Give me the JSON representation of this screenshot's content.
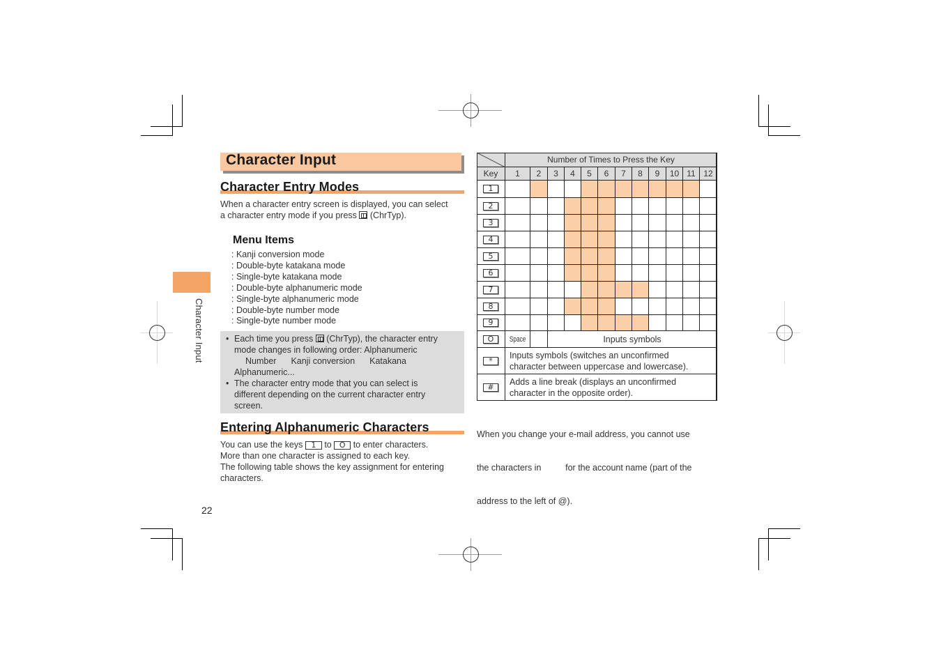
{
  "page": {
    "title": "Character Input",
    "page_number": "22",
    "side_tab_label": "Character Input",
    "accent_color": "#f5a468",
    "title_fill_color": "#fbc79f",
    "highlight_color": "#fbcfa8"
  },
  "section_entry_modes": {
    "heading": "Character Entry Modes",
    "intro_line1": "When a character entry screen is displayed, you can select",
    "intro_line2_before": "a character entry mode if you press ",
    "intro_line2_icon": "chrtyp-key-icon",
    "intro_line2_after": " (ChrTyp).",
    "menu_title": "Menu Items",
    "menu_items": [
      ": Kanji conversion mode",
      ": Double-byte katakana mode",
      ": Single-byte katakana mode",
      ": Double-byte alphanumeric mode",
      ": Single-byte alphanumeric mode",
      ": Double-byte number mode",
      ": Single-byte number mode"
    ],
    "notes": [
      {
        "bullet": "•",
        "line1_before": "Each time you press ",
        "line1_after": " (ChrTyp), the character entry",
        "line2": "mode changes in following order: Alphanumeric",
        "line3_items": [
          "Number",
          "Kanji conversion",
          "Katakana"
        ],
        "line4": "Alphanumeric..."
      },
      {
        "bullet": "•",
        "line1": "The character entry mode that you can select is",
        "line2": "different depending on the current character entry",
        "line3": "screen."
      }
    ]
  },
  "section_alphanumeric": {
    "heading": "Entering Alphanumeric Characters",
    "line1_before": "You can use the keys ",
    "key_from": "1",
    "line1_mid": " to ",
    "key_to": "O",
    "line1_after": " to enter characters.",
    "line2": "More than one character is assigned to each key.",
    "line3": "The following table shows the key assignment for entering",
    "line4": "characters."
  },
  "key_table": {
    "header_caption": "Number of Times to Press the Key",
    "key_column_label": "Key",
    "press_counts": [
      "1",
      "2",
      "3",
      "4",
      "5",
      "6",
      "7",
      "8",
      "9",
      "10",
      "11",
      "12"
    ],
    "rows": [
      {
        "key": "1",
        "highlighted": [
          2,
          5,
          6,
          7,
          8,
          9,
          10,
          11
        ]
      },
      {
        "key": "2",
        "highlighted": [
          4,
          5,
          6
        ]
      },
      {
        "key": "3",
        "highlighted": [
          4,
          5,
          6
        ]
      },
      {
        "key": "4",
        "highlighted": [
          4,
          5,
          6
        ]
      },
      {
        "key": "5",
        "highlighted": [
          4,
          5,
          6
        ]
      },
      {
        "key": "6",
        "highlighted": [
          4,
          5,
          6
        ]
      },
      {
        "key": "7",
        "highlighted": [
          5,
          6,
          7,
          8
        ]
      },
      {
        "key": "8",
        "highlighted": [
          4,
          5,
          6
        ]
      },
      {
        "key": "9",
        "highlighted": [
          5,
          6,
          7,
          8
        ]
      }
    ],
    "zero_row": {
      "key": "O",
      "press1": "Space",
      "rest": "Inputs symbols"
    },
    "star_row": {
      "key": "*",
      "line1": "Inputs symbols (switches an unconfirmed",
      "line2": "character between uppercase and lowercase)."
    },
    "hash_row": {
      "key": "#",
      "line1": "Adds a line break (displays an unconfirmed",
      "line2": "character in the opposite order)."
    }
  },
  "footnote": {
    "line1": "When you change your e-mail address, you cannot use",
    "line2": "the characters in          for the account name (part of the",
    "line3": "address to the left of @)."
  }
}
